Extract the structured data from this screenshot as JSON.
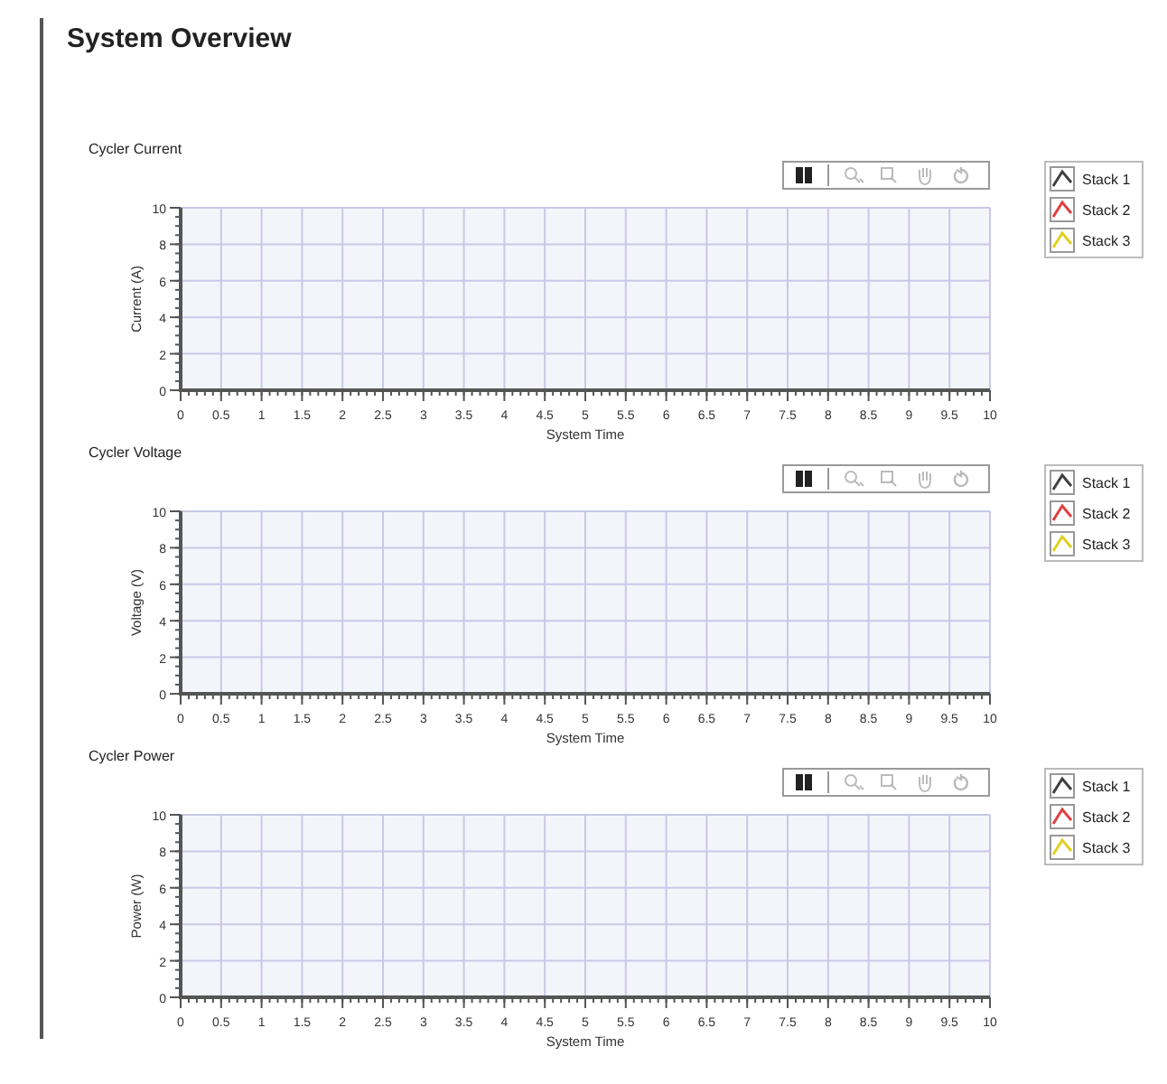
{
  "title": "System Overview",
  "charts": [
    {
      "title": "Cycler Current",
      "toolbar": [
        {
          "kind": "pause",
          "disabled": false
        },
        {
          "kind": "zoom-in",
          "disabled": true
        },
        {
          "kind": "zoom-out",
          "disabled": true
        },
        {
          "kind": "pan",
          "disabled": true
        },
        {
          "kind": "reset",
          "disabled": true
        }
      ],
      "legend": [
        {
          "label": "Stack 1",
          "color": "#404040"
        },
        {
          "label": "Stack 2",
          "color": "#e04040"
        },
        {
          "label": "Stack 3",
          "color": "#e0d020"
        }
      ],
      "chart_data": {
        "type": "line",
        "grid": true,
        "xlabel": "System Time",
        "ylabel": "Current (A)",
        "xlim": [
          0,
          10
        ],
        "ylim": [
          0,
          10
        ],
        "xticks": [
          0,
          0.5,
          1,
          1.5,
          2,
          2.5,
          3,
          3.5,
          4,
          4.5,
          5,
          5.5,
          6,
          6.5,
          7,
          7.5,
          8,
          8.5,
          9,
          9.5,
          10
        ],
        "yticks": [
          0,
          2,
          4,
          6,
          8,
          10
        ]
      }
    },
    {
      "title": "Cycler Voltage",
      "toolbar": [
        {
          "kind": "pause",
          "disabled": false
        },
        {
          "kind": "zoom-in",
          "disabled": true
        },
        {
          "kind": "zoom-out",
          "disabled": true
        },
        {
          "kind": "pan",
          "disabled": true
        },
        {
          "kind": "reset",
          "disabled": true
        }
      ],
      "legend": [
        {
          "label": "Stack 1",
          "color": "#404040"
        },
        {
          "label": "Stack 2",
          "color": "#e04040"
        },
        {
          "label": "Stack 3",
          "color": "#e0d020"
        }
      ],
      "chart_data": {
        "type": "line",
        "grid": true,
        "xlabel": "System Time",
        "ylabel": "Voltage (V)",
        "xlim": [
          0,
          10
        ],
        "ylim": [
          0,
          10
        ],
        "xticks": [
          0,
          0.5,
          1,
          1.5,
          2,
          2.5,
          3,
          3.5,
          4,
          4.5,
          5,
          5.5,
          6,
          6.5,
          7,
          7.5,
          8,
          8.5,
          9,
          9.5,
          10
        ],
        "yticks": [
          0,
          2,
          4,
          6,
          8,
          10
        ]
      }
    },
    {
      "title": "Cycler Power",
      "toolbar": [
        {
          "kind": "pause",
          "disabled": false
        },
        {
          "kind": "zoom-in",
          "disabled": true
        },
        {
          "kind": "zoom-out",
          "disabled": true
        },
        {
          "kind": "pan",
          "disabled": true
        },
        {
          "kind": "reset",
          "disabled": true
        }
      ],
      "legend": [
        {
          "label": "Stack 1",
          "color": "#404040"
        },
        {
          "label": "Stack 2",
          "color": "#e04040"
        },
        {
          "label": "Stack 3",
          "color": "#e0d020"
        }
      ],
      "chart_data": {
        "type": "line",
        "grid": true,
        "xlabel": "System Time",
        "ylabel": "Power (W)",
        "xlim": [
          0,
          10
        ],
        "ylim": [
          0,
          10
        ],
        "xticks": [
          0,
          0.5,
          1,
          1.5,
          2,
          2.5,
          3,
          3.5,
          4,
          4.5,
          5,
          5.5,
          6,
          6.5,
          7,
          7.5,
          8,
          8.5,
          9,
          9.5,
          10
        ],
        "yticks": [
          0,
          2,
          4,
          6,
          8,
          10
        ]
      }
    }
  ]
}
